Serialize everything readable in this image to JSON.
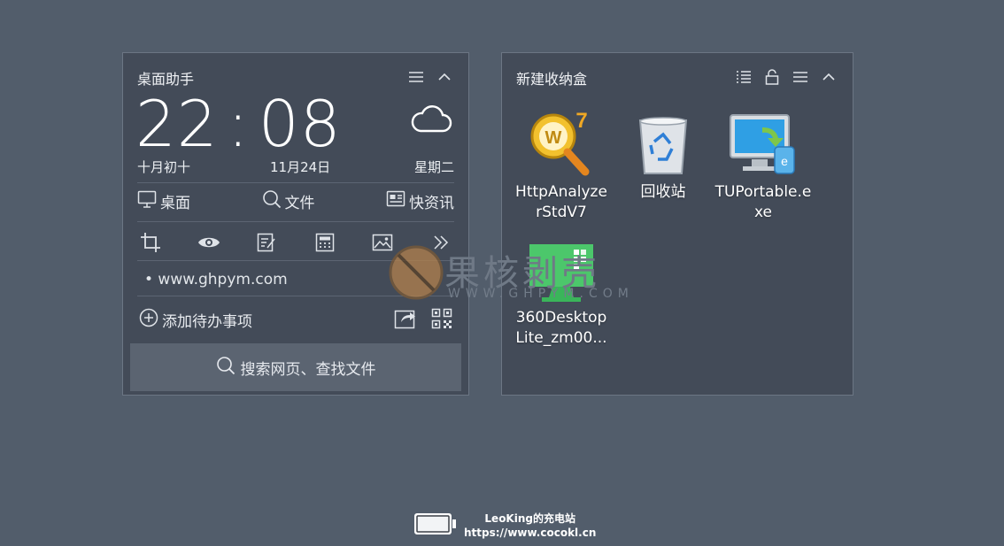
{
  "assistant": {
    "title": "桌面助手",
    "time_hours": "22",
    "time_colon": ":",
    "time_minutes": "08",
    "lunar_date": "十月初十",
    "date": "11月24日",
    "weekday": "星期二",
    "nav": [
      {
        "label": "桌面",
        "icon": "desktop-icon"
      },
      {
        "label": "文件",
        "icon": "search-icon"
      },
      {
        "label": "快资讯",
        "icon": "news-icon"
      }
    ],
    "tools": [
      "crop-icon",
      "eye-icon",
      "edit-icon",
      "calculator-icon",
      "image-icon",
      "more-icon"
    ],
    "note": "• www.ghpym.com",
    "add_todo": "添加待办事项",
    "search_placeholder": "搜索网页、查找文件"
  },
  "box": {
    "title": "新建收纳盒",
    "icons": [
      {
        "label": "HttpAnalyzerStdV7",
        "icon": "httpanalyzer-app-icon"
      },
      {
        "label": "回收站",
        "icon": "recycle-bin-icon"
      },
      {
        "label": "TUPortable.exe",
        "icon": "tuportable-app-icon"
      },
      {
        "label": "360DesktopLite_zm00...",
        "icon": "360desktop-app-icon"
      }
    ]
  },
  "watermark": {
    "main": "果核剥壳",
    "sub": "WWW.GHPYM.COM"
  },
  "footer": {
    "line1": "LeoKing的充电站",
    "line2": "https://www.cocokl.cn"
  },
  "colors": {
    "background": "#525d6b",
    "panel": "#434b58",
    "search_bar": "#5b6471"
  }
}
